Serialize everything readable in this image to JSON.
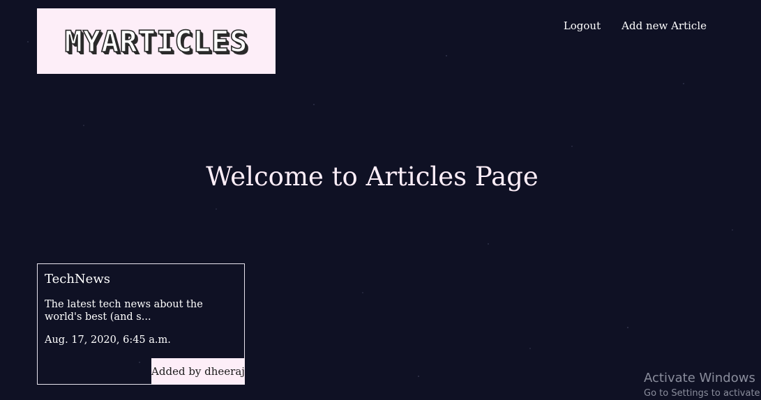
{
  "header": {
    "logo_text": "MYARTICLES",
    "nav": {
      "logout_label": "Logout",
      "add_article_label": "Add new Article"
    }
  },
  "main": {
    "heading": "Welcome to Articles Page",
    "articles": [
      {
        "title": "TechNews",
        "excerpt": "The latest tech news about the world's best (and s...",
        "date": "Aug. 17, 2020, 6:45 a.m.",
        "author_label": "Added by dheeraj"
      }
    ]
  },
  "os_overlay": {
    "title": "Activate Windows",
    "subtitle": "Go to Settings to activate"
  },
  "colors": {
    "background": "#0f1124",
    "accent_pink": "#fdeef8",
    "text": "#ffffff"
  }
}
